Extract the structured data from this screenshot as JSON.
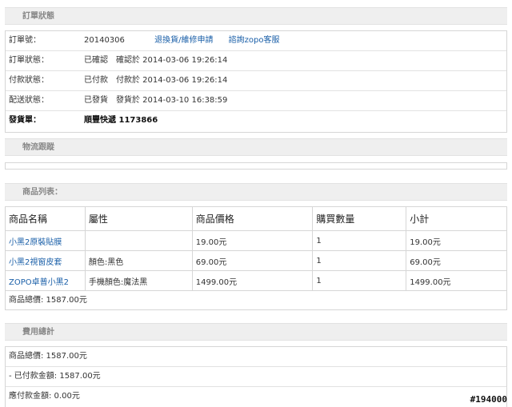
{
  "order_status_section": {
    "title": "訂單狀態"
  },
  "order_info": {
    "order_no": {
      "label": "訂單號：",
      "value": "20140306",
      "link1": "退換貨/維修申請",
      "link2": "諮詢zopo客服"
    },
    "order_status": {
      "label": "訂單狀態：",
      "value": "已確認",
      "time_label": "確認於 2014-03-06 19:26:14"
    },
    "payment_status": {
      "label": "付款狀態：",
      "value": "已付款",
      "time_label": "付款於 2014-03-06 19:26:14"
    },
    "shipping_status": {
      "label": "配送狀態：",
      "value": "已發貨",
      "time_label": "發貨於 2014-03-10 16:38:59"
    },
    "delivery_note": {
      "label": "發貨單：",
      "value": "順豐快遞 1173866"
    }
  },
  "logistics_section": {
    "title": "物流跟蹤"
  },
  "product_section": {
    "title": "商品列表："
  },
  "product_table": {
    "headers": [
      "商品名稱",
      "屬性",
      "商品價格",
      "購買數量",
      "小計"
    ],
    "rows": [
      {
        "name": "小黑2原裝貼膜",
        "attr": "",
        "price": "19.00元",
        "qty": "1",
        "subtotal": "19.00元"
      },
      {
        "name": "小黑2視窗皮套",
        "attr": "顏色:黑色",
        "price": "69.00元",
        "qty": "1",
        "subtotal": "69.00元"
      },
      {
        "name": "ZOPO卓普小黑2",
        "attr": "手機顏色:魔法黑",
        "price": "1499.00元",
        "qty": "1",
        "subtotal": "1499.00元"
      }
    ],
    "total": "商品總價: 1587.00元"
  },
  "fee_section": {
    "title": "費用總計"
  },
  "fee_summary": {
    "goods_total": "商品總價: 1587.00元",
    "paid": "- 已付款金額: 1587.00元",
    "due": "應付款金額: 0.00元"
  },
  "watermark": "#194000"
}
